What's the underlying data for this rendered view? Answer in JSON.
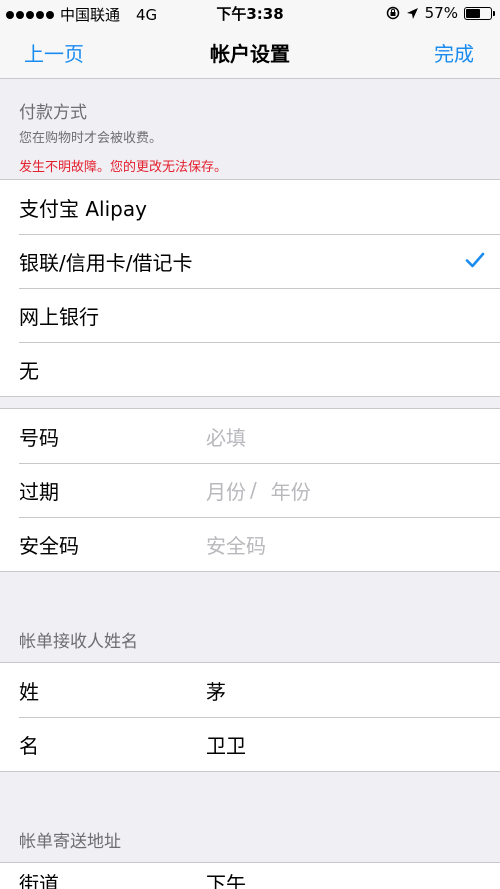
{
  "status_bar": {
    "carrier": "中国联通",
    "network": "4G",
    "time": "下午3:38",
    "battery_percent": "57%",
    "battery_level": 0.57
  },
  "nav": {
    "back_label": "上一页",
    "title": "帐户设置",
    "done_label": "完成"
  },
  "payment_section": {
    "title": "付款方式",
    "subtitle": "您在购物时才会被收费。",
    "error": "发生不明故障。您的更改无法保存。",
    "options": [
      {
        "label": "支付宝 Alipay",
        "selected": false
      },
      {
        "label": "银联/信用卡/借记卡",
        "selected": true
      },
      {
        "label": "网上银行",
        "selected": false
      },
      {
        "label": "无",
        "selected": false
      }
    ]
  },
  "card_fields": {
    "number_label": "号码",
    "number_placeholder": "必填",
    "expiry_label": "过期",
    "expiry_month_placeholder": "月份",
    "expiry_separator": "/",
    "expiry_year_placeholder": "年份",
    "cvv_label": "安全码",
    "cvv_placeholder": "安全码"
  },
  "billing_name": {
    "title": "帐单接收人姓名",
    "last_name_label": "姓",
    "last_name_value": "茅",
    "first_name_label": "名",
    "first_name_value": "卫卫"
  },
  "billing_address": {
    "title": "帐单寄送地址",
    "street_label": "街道",
    "street_value": "下午"
  },
  "colors": {
    "accent": "#1a8cf0",
    "error": "#e5202e",
    "background": "#efeff4"
  }
}
